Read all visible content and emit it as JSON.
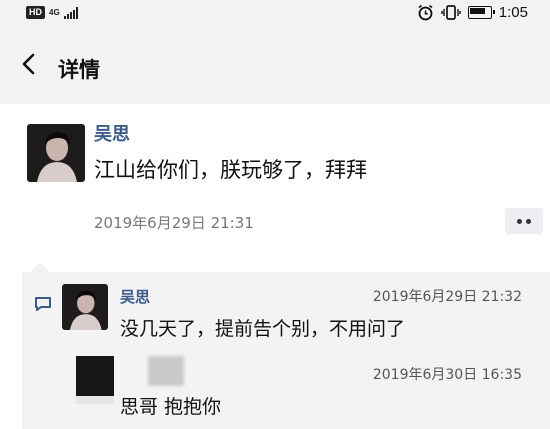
{
  "status_bar": {
    "hd_label": "HD",
    "network_label": "4G",
    "time": "1:05"
  },
  "header": {
    "title": "详情"
  },
  "post": {
    "author": "吴思",
    "text": "江山给你们，朕玩够了，拜拜",
    "timestamp": "2019年6月29日 21:31"
  },
  "comments": [
    {
      "author": "吴思",
      "timestamp": "2019年6月29日 21:32",
      "text": "没几天了，提前告个别，不用问了"
    },
    {
      "author": "",
      "timestamp": "2019年6月30日 16:35",
      "text": "思哥 抱抱你"
    }
  ],
  "colors": {
    "name_link": "#3c5a8a",
    "header_bg": "#f2f2f2",
    "comment_bg": "#f3f3f5"
  }
}
